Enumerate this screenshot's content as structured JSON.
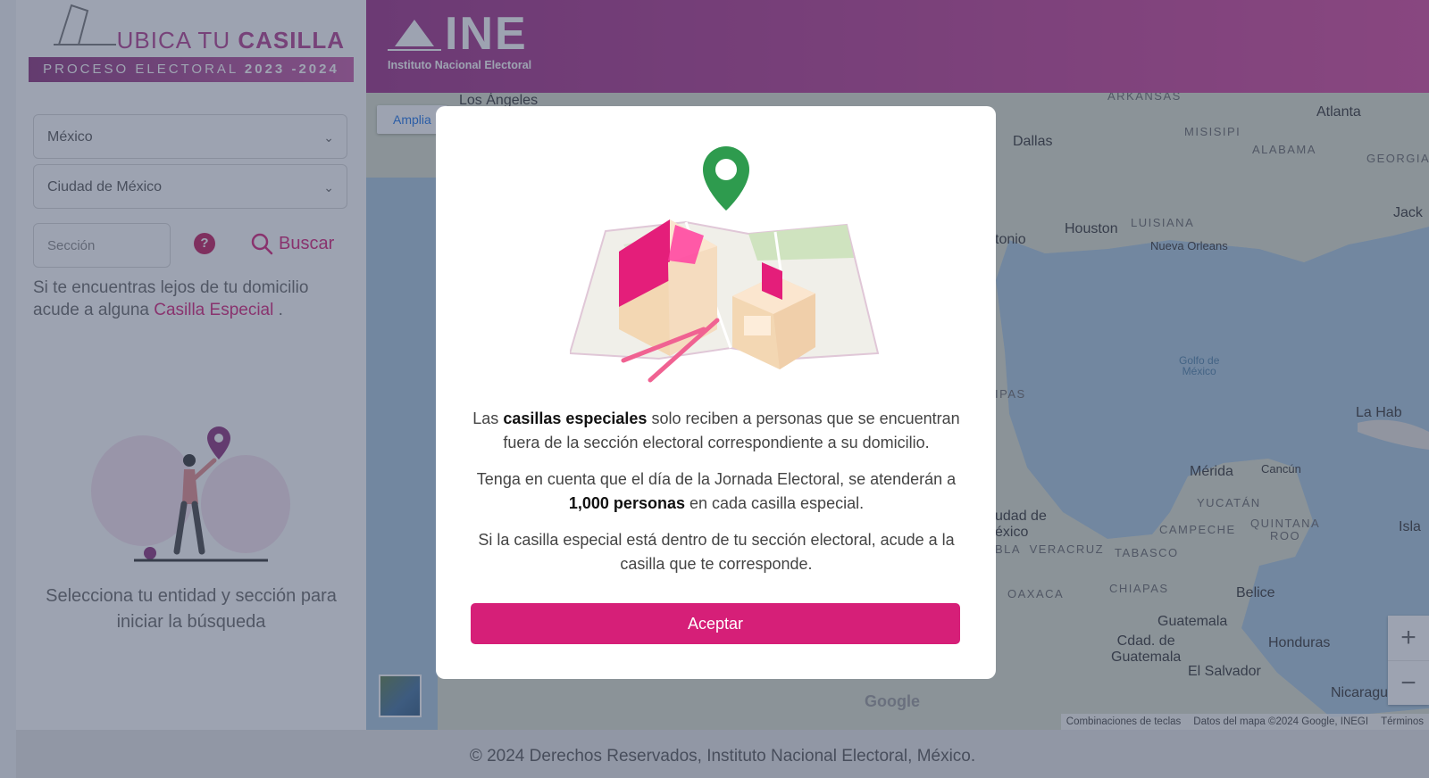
{
  "brand": {
    "title_light": "UBICA TU",
    "title_bold": "CASILLA",
    "process_label": "PROCESO ELECTORAL",
    "process_years": "2023 -2024",
    "ine_short": "INE",
    "ine_full": "Instituto Nacional Electoral"
  },
  "sidebar": {
    "entity_select": "México",
    "municipality_select": "Ciudad de México",
    "section_placeholder": "Sección",
    "search_label": "Buscar",
    "far_text": "Si te encuentras lejos de tu domicilio acude a alguna",
    "special_link": "Casilla Especial",
    "special_link_suffix": ".",
    "hint": "Selecciona tu entidad y sección para iniciar la búsqueda"
  },
  "map": {
    "expand_button": "Amplia",
    "labels": {
      "los_angeles": "Los Ángeles",
      "arkansas": "ARKANSAS",
      "atlanta": "Atlanta",
      "dallas": "Dallas",
      "misisipi": "MISISIPI",
      "alabama": "ALABAMA",
      "georgia": "GEORGIA",
      "jack": "Jack",
      "houston": "Houston",
      "antonio": "tonio",
      "luisiana": "LUISIANA",
      "nueva_orleans": "Nueva Orleans",
      "golfo": "Golfo de\nMéxico",
      "ipas": "IPAS",
      "la_hab": "La Hab",
      "merida": "Mérida",
      "cancun": "Cancún",
      "yucatan": "YUCATÁN",
      "ciudad_de": "udad de\néxico",
      "campeche": "CAMPECHE",
      "quintana": "QUINTANA\nROO",
      "isla": "Isla",
      "veracruz": "BLA  VERACRUZ",
      "tabasco": "TABASCO",
      "oaxaca": "OAXACA",
      "chiapas": "CHIAPAS",
      "belice": "Belice",
      "guatemala": "Guatemala",
      "cdad_guatemala": "Cdad. de\nGuatemala",
      "honduras": "Honduras",
      "el_salvador": "El Salvador",
      "nicaragua": "Nicaragua"
    },
    "google_logo": "Google",
    "attribution": [
      "Combinaciones de teclas",
      "Datos del mapa ©2024 Google, INEGI",
      "Términos"
    ],
    "zoom_in": "+",
    "zoom_out": "−"
  },
  "modal": {
    "p1_a": "Las ",
    "p1_bold": "casillas especiales",
    "p1_b": " solo reciben a personas que se encuentran fuera de la sección electoral correspondiente a su domicilio.",
    "p2_a": "Tenga en cuenta que el día de la Jornada Electoral, se atenderán a ",
    "p2_bold": "1,000 personas",
    "p2_b": " en cada casilla especial.",
    "p3": "Si la casilla especial está dentro de tu sección electoral, acude a la casilla que te corresponde.",
    "accept_button": "Aceptar"
  },
  "footer": {
    "text": "© 2024 Derechos Reservados, Instituto Nacional Electoral, México."
  },
  "colors": {
    "accent": "#d61f78",
    "header_start": "#9c2d85",
    "header_end": "#d5469c"
  }
}
